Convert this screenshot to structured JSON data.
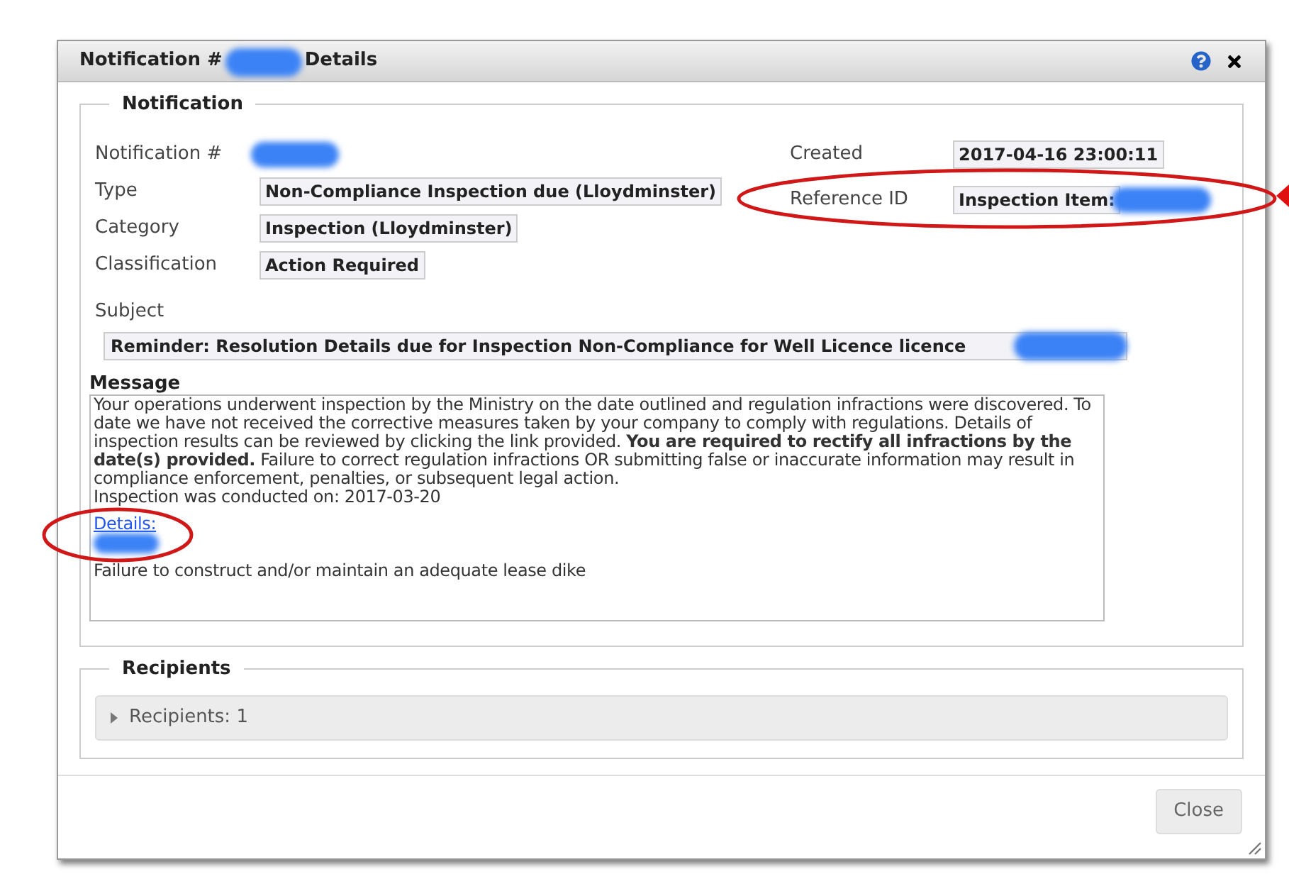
{
  "dialog": {
    "title": {
      "prefix": "Notification #",
      "suffix": "Details",
      "redacted": true
    },
    "notification": {
      "legend": "Notification",
      "left_fields": [
        {
          "label": "Notification #",
          "redacted": true
        },
        {
          "label": "Type",
          "value": "Non-Compliance Inspection due (Lloydminster)",
          "redacted": false
        },
        {
          "label": "Category",
          "value": "Inspection (Lloydminster)",
          "redacted": false
        },
        {
          "label": "Classification",
          "value": "Action Required",
          "redacted": false
        }
      ],
      "right_fields": [
        {
          "label": "Created",
          "value": "2017-04-16 23:00:11",
          "redacted": false
        },
        {
          "label": "Reference ID",
          "value": "Inspection Item:",
          "redacted": true
        }
      ],
      "subject": {
        "label": "Subject",
        "value": "Reminder: Resolution Details due for Inspection Non-Compliance for Well Licence licence",
        "redacted": true
      },
      "message": {
        "label": "Message",
        "body": "Your operations underwent inspection by the Ministry on the date outlined and regulation infractions were discovered. To date we have not received the corrective measures taken by your company to comply with regulations. Details of inspection results can be reviewed by clicking the link provided. **You are required to rectify all infractions by the date(s) provided.** Failure to correct regulation infractions OR submitting false or inaccurate information may result in compliance enforcement, penalties, or subsequent legal action.",
        "conducted": "Inspection was conducted on: 2017-03-20",
        "link": "Details:",
        "link_redacted": true,
        "finding": "Failure to construct and/or maintain an adequate lease dike"
      }
    },
    "recipients": {
      "legend": "Recipients",
      "summary": "Recipients: 1",
      "expanded": false
    },
    "buttons": [
      "Close"
    ]
  }
}
